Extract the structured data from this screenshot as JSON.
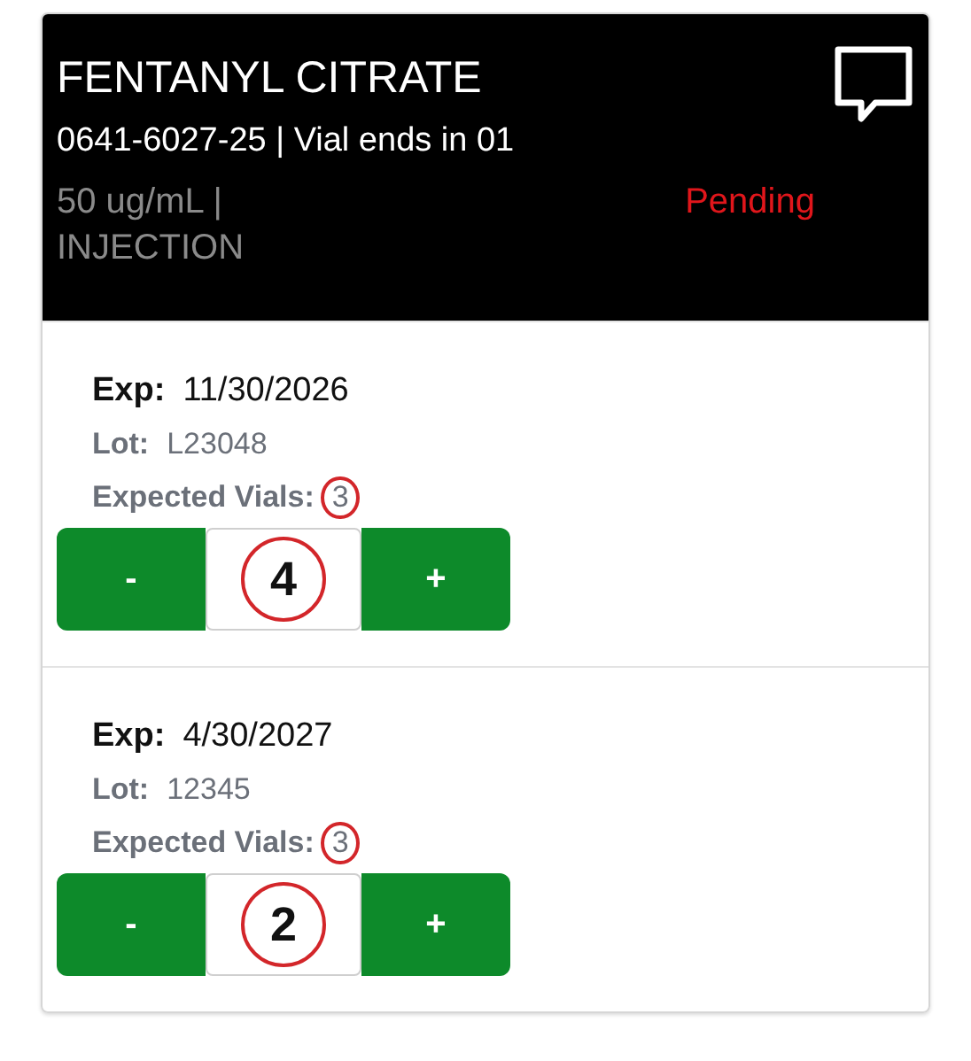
{
  "header": {
    "title": "FENTANYL CITRATE",
    "subtitle": "0641-6027-25 | Vial ends in 01",
    "strength": "50 ug/mL |",
    "form": "INJECTION",
    "status": "Pending"
  },
  "lots": [
    {
      "exp_label": "Exp:",
      "exp": "11/30/2026",
      "lot_label": "Lot:",
      "lot": "L23048",
      "expected_label": "Expected Vials:",
      "expected": "3",
      "expected_circled": true,
      "minus": "-",
      "count": "4",
      "count_circled": true,
      "plus": "+"
    },
    {
      "exp_label": "Exp:",
      "exp": "4/30/2027",
      "lot_label": "Lot:",
      "lot": "12345",
      "expected_label": "Expected Vials:",
      "expected": "3",
      "expected_circled": true,
      "minus": "-",
      "count": "2",
      "count_circled": true,
      "plus": "+"
    }
  ]
}
